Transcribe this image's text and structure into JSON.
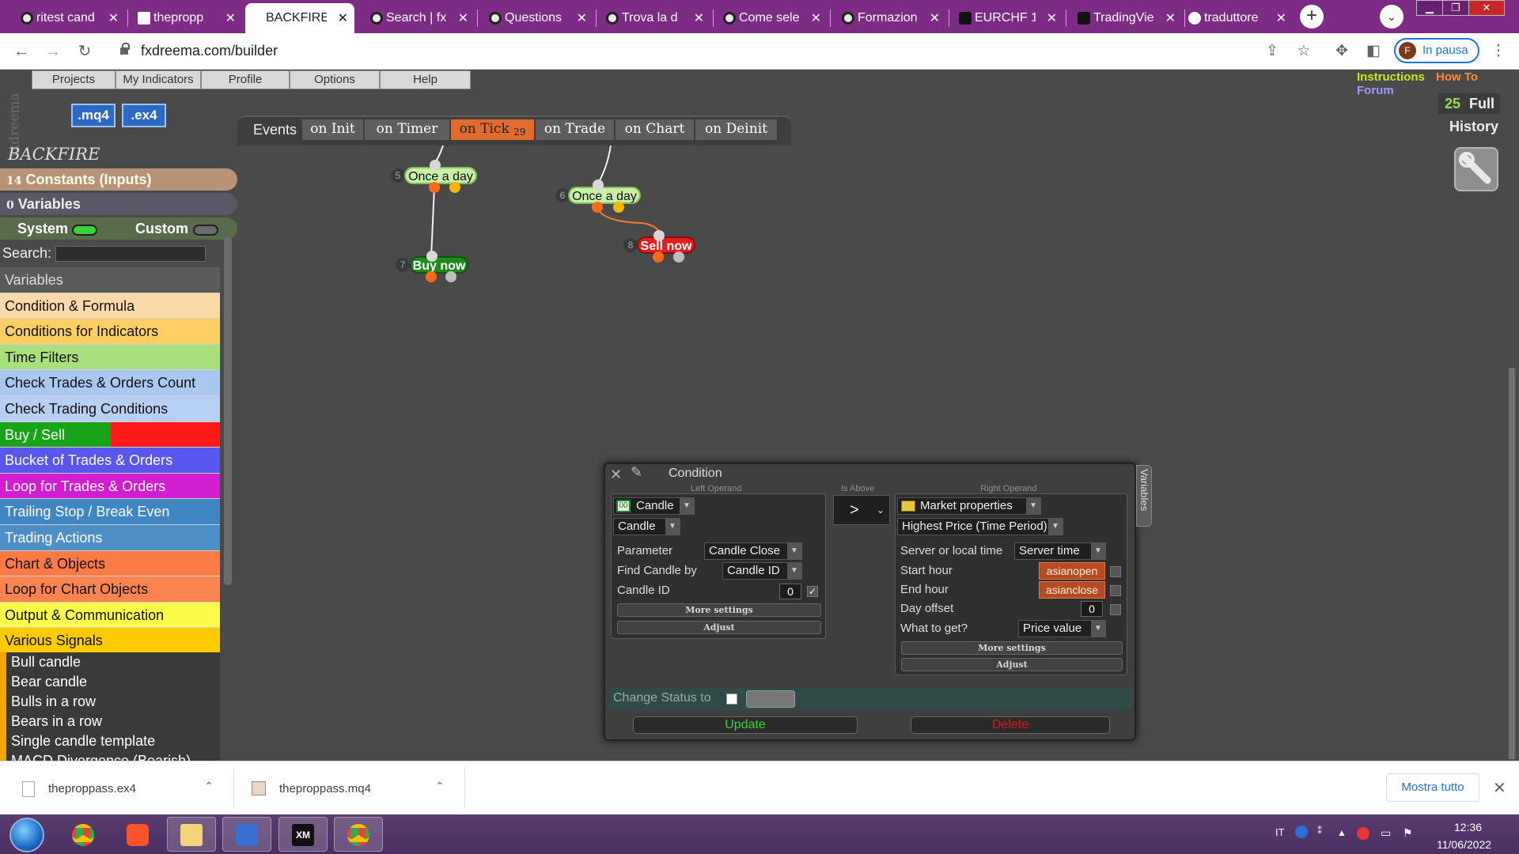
{
  "browser": {
    "tabs": [
      {
        "label": "ritest cand",
        "icon": "extension-icon"
      },
      {
        "label": "thepropp",
        "icon": "fxdreema-icon"
      },
      {
        "label": "BACKFIRE",
        "icon": "fxdreema-icon"
      },
      {
        "label": "Search | fx",
        "icon": "extension-icon"
      },
      {
        "label": "Questions",
        "icon": "extension-icon"
      },
      {
        "label": "Trova la d",
        "icon": "extension-icon"
      },
      {
        "label": "Come sele",
        "icon": "extension-icon"
      },
      {
        "label": "Formazion",
        "icon": "extension-icon"
      },
      {
        "label": "EURCHF 1",
        "icon": "tradingview-icon"
      },
      {
        "label": "TradingVie",
        "icon": "tradingview-icon"
      },
      {
        "label": "traduttore",
        "icon": "google-icon"
      }
    ],
    "active_tab_index": 2,
    "close_glyph": "✕",
    "new_tab_glyph": "+",
    "url": "fxdreema.com/builder",
    "profile_initial": "F",
    "profile_label": "In pausa"
  },
  "app": {
    "brand_vertical": "fxdreema",
    "menu": [
      "Projects",
      "My Indicators",
      "Profile",
      "Options",
      "Help"
    ],
    "export_buttons": [
      ".mq4",
      ".ex4"
    ],
    "links": {
      "instructions": "Instructions",
      "how_to": "How To",
      "forum": "Forum"
    },
    "full_count": "25",
    "full_label": "Full",
    "history_label": "History",
    "events": {
      "label": "Events",
      "tabs": [
        "on Init",
        "on Timer",
        "on Tick",
        "on Trade",
        "on Chart",
        "on Deinit"
      ],
      "active": "on Tick",
      "tick_badge": "29"
    },
    "sidebar": {
      "project_name": "BACKFIRE",
      "constants_count": "14",
      "constants_label": "Constants (Inputs)",
      "variables_count": "0",
      "variables_label": "Variables",
      "system_label": "System",
      "custom_label": "Custom",
      "search_label": "Search:",
      "categories": [
        {
          "label": "Variables",
          "color": "#5a5a5a"
        },
        {
          "label": "Condition & Formula",
          "color": "#fcd9a8"
        },
        {
          "label": "Conditions for Indicators",
          "color": "#ffcf63"
        },
        {
          "label": "Time Filters",
          "color": "#a9e07e"
        },
        {
          "label": "Check Trades & Orders Count",
          "color": "#a8c8f0"
        },
        {
          "label": "Check Trading Conditions",
          "color": "#b7cff2"
        },
        {
          "label": "Buy / Sell",
          "color": "#19a319"
        },
        {
          "label": "Bucket of Trades & Orders",
          "color": "#5a56f0"
        },
        {
          "label": "Loop for Trades & Orders",
          "color": "#d11ed1"
        },
        {
          "label": "Trailing Stop / Break Even",
          "color": "#3f86c2"
        },
        {
          "label": "Trading Actions",
          "color": "#4f8fc8"
        },
        {
          "label": "Chart & Objects",
          "color": "#fb7a46"
        },
        {
          "label": "Loop for Chart Objects",
          "color": "#fb8450"
        },
        {
          "label": "Output & Communication",
          "color": "#fbfb4a"
        },
        {
          "label": "Various Signals",
          "color": "#ffca00"
        }
      ],
      "buy_sell_second_color": "#ff1a1a",
      "signals": [
        "Bull candle",
        "Bear candle",
        "Bulls in a row",
        "Bears in a row",
        "Single candle template",
        "MACD Divergence (Bearish)"
      ]
    },
    "blocks": [
      {
        "id": "5",
        "label": "Once a day",
        "kind": "green"
      },
      {
        "id": "6",
        "label": "Once a day",
        "kind": "green"
      },
      {
        "id": "7",
        "label": "Buy now",
        "kind": "buy"
      },
      {
        "id": "8",
        "label": "Sell now",
        "kind": "sell"
      }
    ]
  },
  "condition": {
    "title": "Condition",
    "side_tab": "Variables",
    "left_operand_label": "Left Operand",
    "operator_label": "Is Above",
    "right_operand_label": "Right Operand",
    "operator": ">",
    "left": {
      "type": "Candle",
      "type_icon": "00",
      "sub": "Candle",
      "rows": [
        {
          "label": "Parameter",
          "value": "Candle Close"
        },
        {
          "label": "Find Candle by",
          "value": "Candle ID"
        },
        {
          "label": "Candle ID",
          "value": "0"
        }
      ],
      "candle_id_checked": true,
      "more": "More settings",
      "adjust": "Adjust"
    },
    "right": {
      "type": "Market properties",
      "sub": "Highest Price (Time Period)",
      "rows": [
        {
          "label": "Server or local time",
          "value": "Server time"
        },
        {
          "label": "Start hour",
          "value": "asianopen"
        },
        {
          "label": "End hour",
          "value": "asianclose"
        },
        {
          "label": "Day offset",
          "value": "0"
        },
        {
          "label": "What to get?",
          "value": "Price value"
        }
      ],
      "more": "More settings",
      "adjust": "Adjust"
    },
    "change_status_label": "Change Status to",
    "update_label": "Update",
    "delete_label": "Delete"
  },
  "downloads": {
    "items": [
      {
        "name": "theproppass.ex4"
      },
      {
        "name": "theproppass.mq4"
      }
    ],
    "show_all": "Mostra tutto"
  },
  "taskbar": {
    "lang": "IT",
    "time": "12:36",
    "date": "11/06/2022"
  }
}
